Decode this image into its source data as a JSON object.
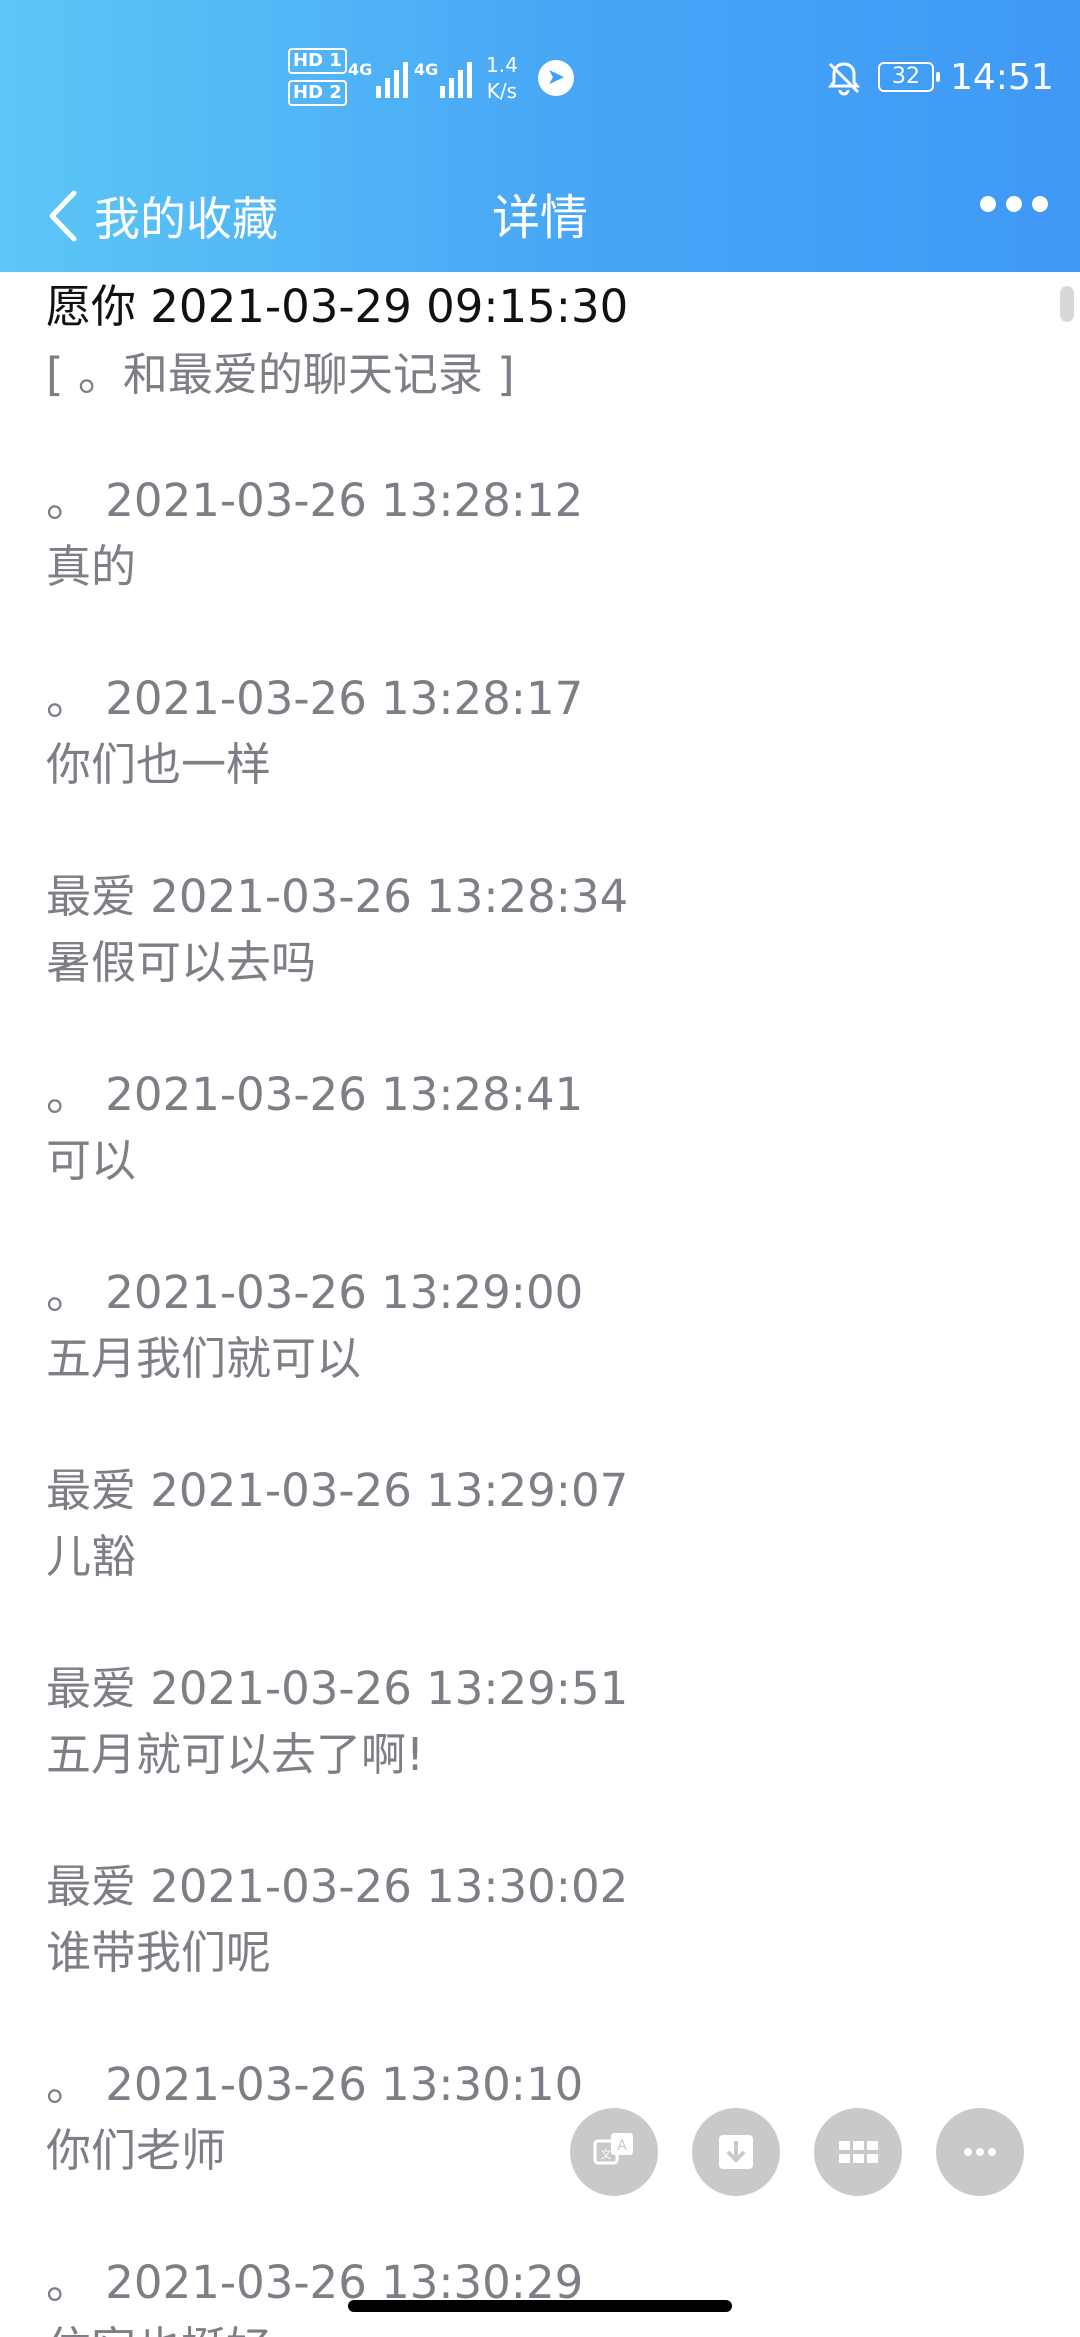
{
  "status_bar": {
    "hd1": "HD 1",
    "hd2": "HD 2",
    "net1": "4G",
    "net2": "4G",
    "speed_value": "1.4",
    "speed_unit": "K/s",
    "battery": "32",
    "time": "14:51"
  },
  "nav": {
    "back_label": "我的收藏",
    "title": "详情"
  },
  "header": {
    "line": "愿你 2021-03-29 09:15:30",
    "subline": "[ 。和最爱的聊天记录 ]"
  },
  "messages": [
    {
      "meta": "。 2021-03-26 13:28:12",
      "text": "真的"
    },
    {
      "meta": "。 2021-03-26 13:28:17",
      "text": "你们也一样"
    },
    {
      "meta": "最爱 2021-03-26 13:28:34",
      "text": "暑假可以去吗"
    },
    {
      "meta": "。 2021-03-26 13:28:41",
      "text": "可以"
    },
    {
      "meta": "。 2021-03-26 13:29:00",
      "text": "五月我们就可以"
    },
    {
      "meta": "最爱 2021-03-26 13:29:07",
      "text": "儿豁"
    },
    {
      "meta": "最爱 2021-03-26 13:29:51",
      "text": "五月就可以去了啊!"
    },
    {
      "meta": "最爱 2021-03-26 13:30:02",
      "text": "谁带我们呢"
    },
    {
      "meta": "。 2021-03-26 13:30:10",
      "text": "你们老师"
    },
    {
      "meta": "。 2021-03-26 13:30:29",
      "text": "住宿也挺好"
    }
  ],
  "fabs": [
    {
      "icon": "translate-icon"
    },
    {
      "icon": "download-icon"
    },
    {
      "icon": "grid-icon"
    },
    {
      "icon": "more-icon"
    }
  ]
}
